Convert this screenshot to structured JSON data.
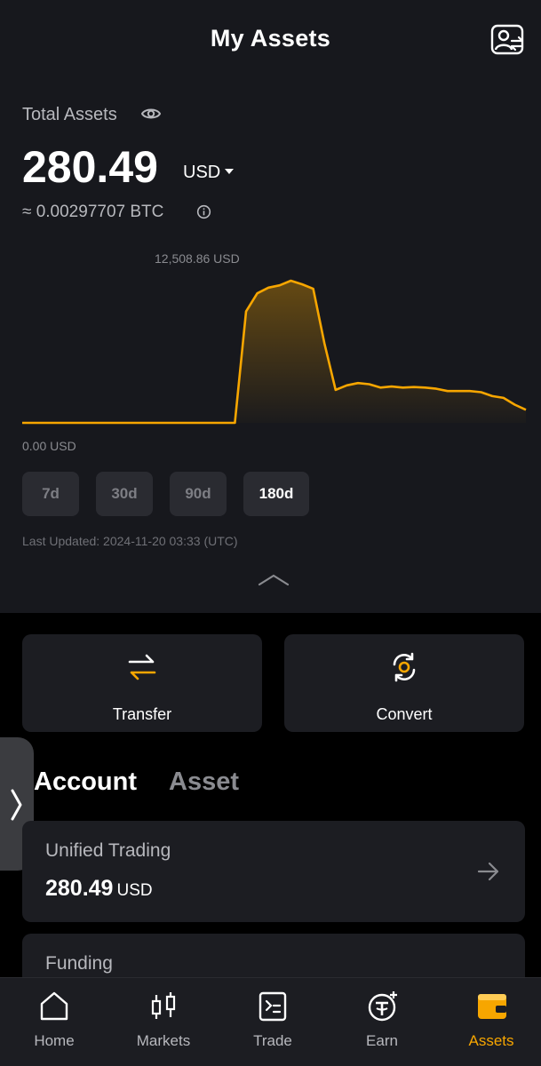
{
  "header": {
    "title": "My Assets",
    "right_icon": "profile-switch-icon"
  },
  "total": {
    "label": "Total Assets",
    "amount": "280.49",
    "currency": "USD",
    "btc_equiv": "≈ 0.00297707 BTC"
  },
  "chart_data": {
    "type": "area",
    "max_label": "12,508.86 USD",
    "min_label": "0.00 USD",
    "line_color": "#f7a600",
    "x": [
      0,
      4,
      8,
      12,
      16,
      20,
      24,
      28,
      32,
      36,
      40,
      44,
      48,
      52,
      56,
      60,
      64,
      68,
      72,
      76,
      80,
      84,
      88,
      92,
      96,
      100,
      104,
      108,
      112,
      116,
      120,
      124,
      128,
      132,
      136,
      140,
      144,
      148,
      152,
      156,
      160,
      164,
      168,
      172,
      176,
      180
    ],
    "values": [
      0,
      0,
      0,
      0,
      0,
      0,
      0,
      0,
      0,
      0,
      0,
      0,
      0,
      0,
      0,
      0,
      0,
      0,
      0,
      0,
      9800,
      11400,
      11900,
      12100,
      12508.86,
      12200,
      11800,
      7000,
      2900,
      3300,
      3500,
      3400,
      3100,
      3200,
      3100,
      3150,
      3100,
      3000,
      2800,
      2800,
      2800,
      2700,
      2350,
      2200,
      1600,
      1150
    ],
    "ylim": [
      0,
      12508.86
    ],
    "ranges": [
      "7d",
      "30d",
      "90d",
      "180d"
    ],
    "active_range": "180d"
  },
  "last_updated": "Last Updated: 2024-11-20 03:33 (UTC)",
  "actions": [
    {
      "label": "Transfer",
      "icon": "transfer-icon"
    },
    {
      "label": "Convert",
      "icon": "convert-icon"
    }
  ],
  "tabs": [
    {
      "label": "Account",
      "active": true
    },
    {
      "label": "Asset",
      "active": false
    }
  ],
  "accounts": [
    {
      "name": "Unified Trading",
      "amount": "280.49",
      "currency": "USD"
    },
    {
      "name": "Funding",
      "amount": "",
      "currency": ""
    }
  ],
  "nav": [
    {
      "label": "Home",
      "icon": "home-icon"
    },
    {
      "label": "Markets",
      "icon": "candlestick-icon"
    },
    {
      "label": "Trade",
      "icon": "trade-icon"
    },
    {
      "label": "Earn",
      "icon": "earn-icon"
    },
    {
      "label": "Assets",
      "icon": "wallet-icon",
      "active": true
    }
  ],
  "colors": {
    "accent": "#f7a600",
    "bg_top": "#17181d",
    "card": "#1c1d22"
  }
}
